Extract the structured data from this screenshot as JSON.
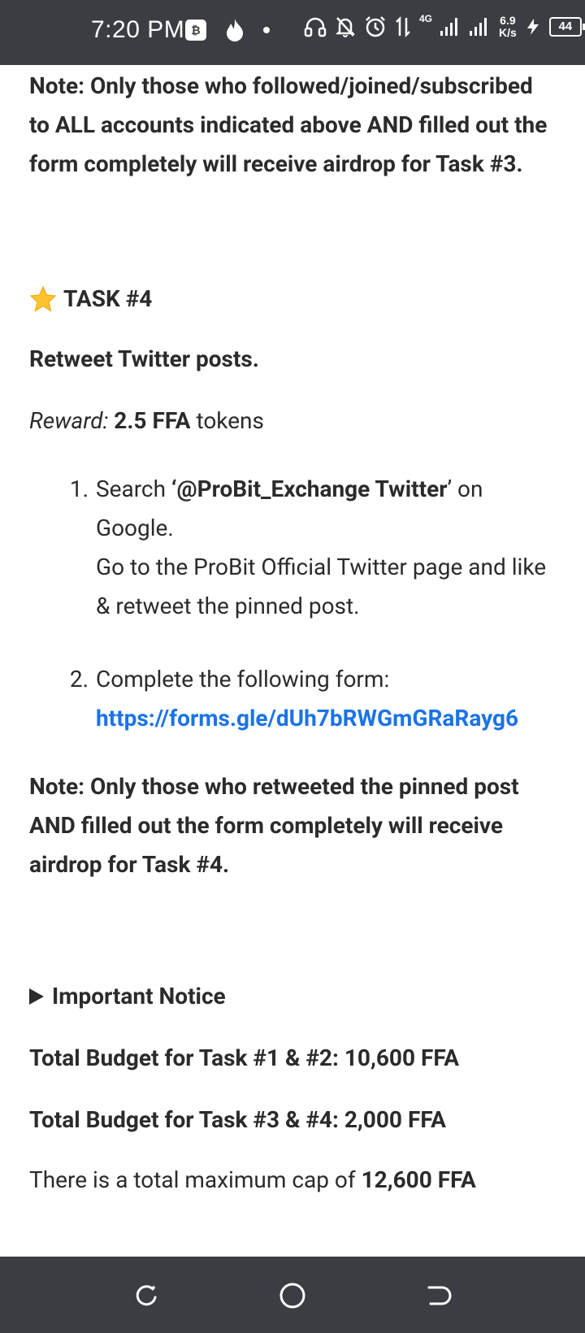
{
  "status_bar": {
    "time": "7:20 PM",
    "network_gen": "4G",
    "speed_value": "6.9",
    "speed_unit": "K/s",
    "battery": "44",
    "icons": [
      "coin-icon",
      "flame-icon",
      "dot-icon",
      "headset-icon",
      "bell-off-icon",
      "alarm-icon",
      "data-arrows-icon",
      "signal-icon",
      "signal-icon",
      "charging-icon",
      "battery-icon"
    ]
  },
  "article": {
    "note_task3": "Note: Only those who followed/joined/subscribed to ALL accounts indicated above AND filled out the form completely will receive airdrop for Task #3.",
    "task4_heading": "TASK #4",
    "task4_subtitle": "Retweet Twitter posts.",
    "reward_label": "Reward:",
    "reward_value": "2.5 FFA",
    "reward_unit": "tokens",
    "steps": [
      {
        "prefix": "Search ",
        "bold": "‘@ProBit_Exchange Twitter",
        "suffix": "’ on Google.",
        "line2": "Go to the ProBit Official Twitter page and like & retweet the pinned post."
      },
      {
        "text": "Complete the following form:",
        "link": "https://forms.gle/dUh7bRWGmGRaRayg6"
      }
    ],
    "note_task4": "Note: Only those who retweeted the pinned post AND filled out the form completely will receive airdrop for Task #4.",
    "notice_heading": "Important Notice",
    "budget_1": "Total Budget for Task #1 & #2: 10,600 FFA",
    "budget_2": "Total Budget for Task #3 & #4: 2,000 FFA",
    "cap_prefix": "There is a total maximum cap of ",
    "cap_value": "12,600 FFA"
  },
  "nav_bar": {
    "buttons": [
      "recent-apps-button",
      "home-button",
      "back-button"
    ]
  },
  "colors": {
    "system_bar": "#3b3d42",
    "link": "#1a73e8",
    "text": "#2b2b2b"
  }
}
